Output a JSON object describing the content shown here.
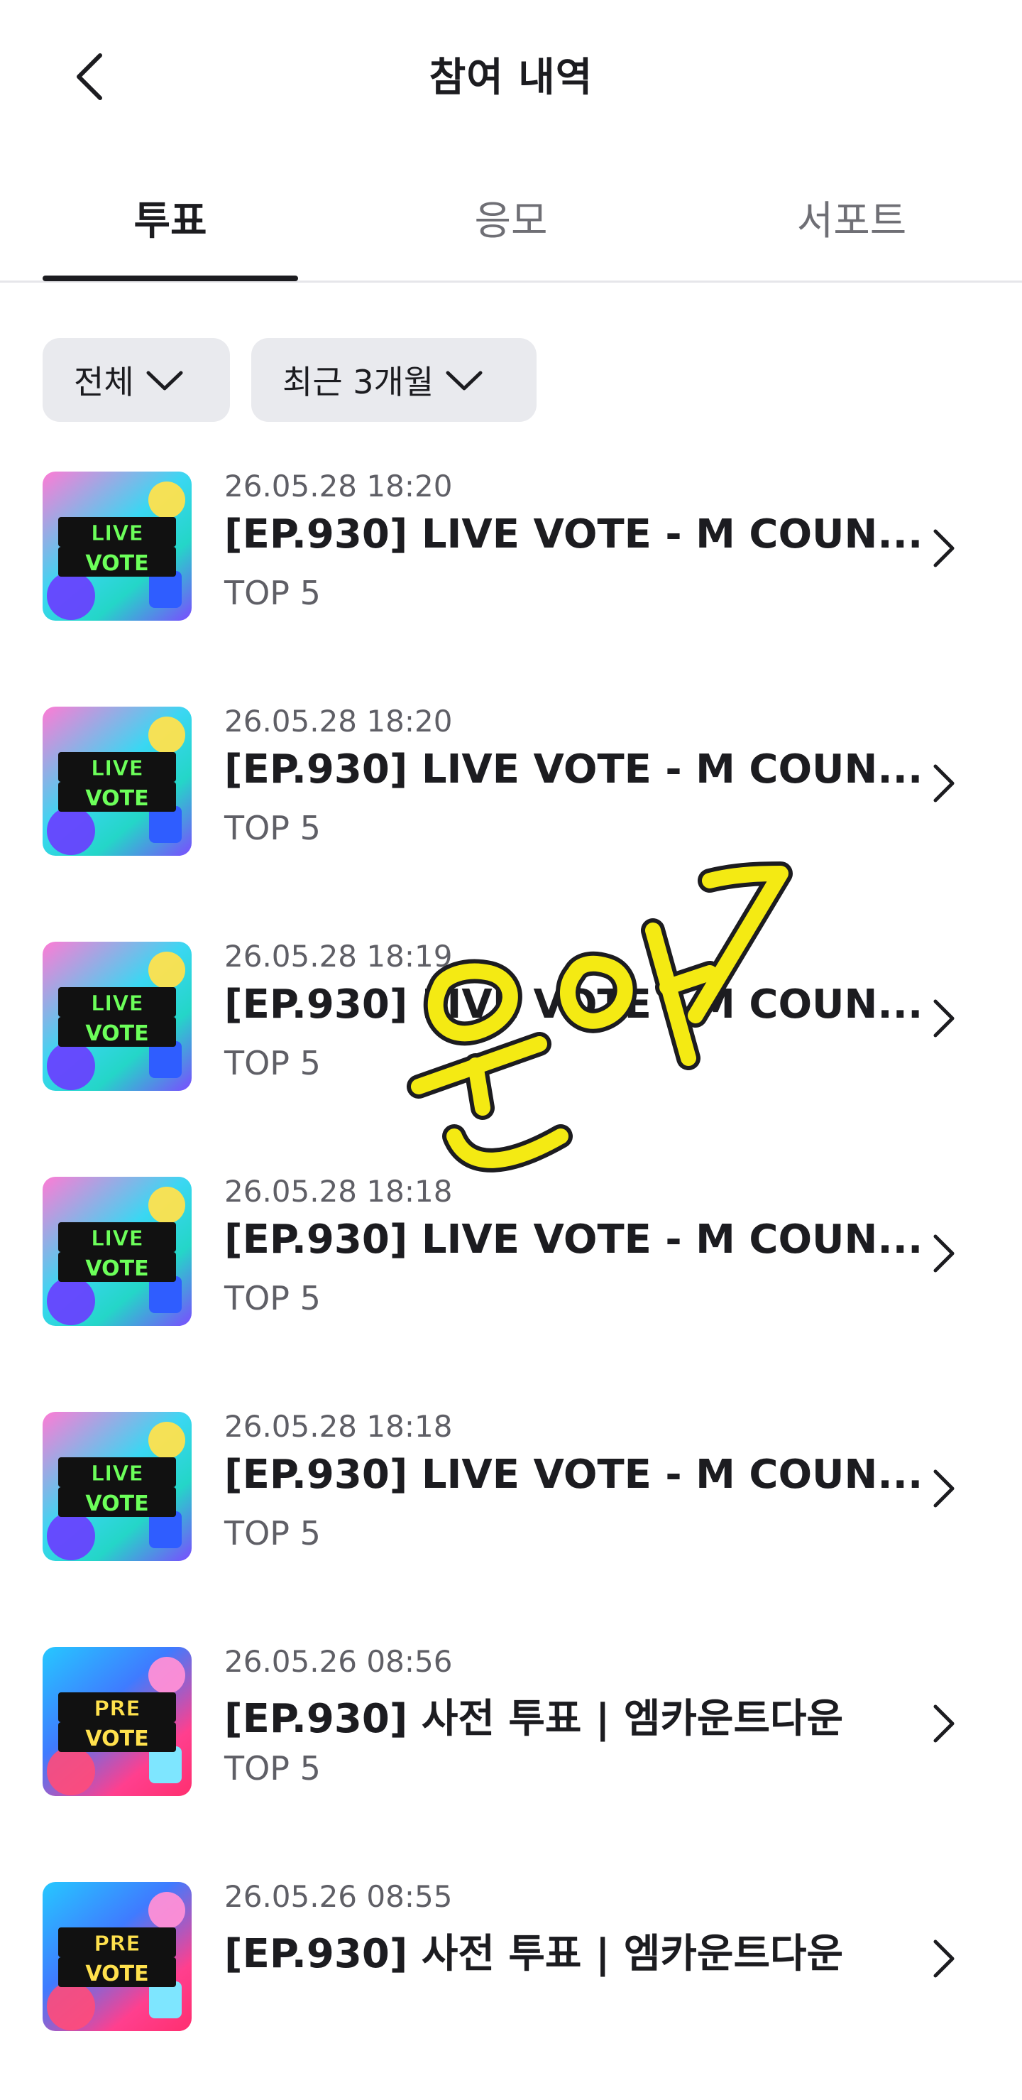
{
  "header": {
    "title": "참여 내역"
  },
  "tabs": [
    {
      "label": "투표"
    },
    {
      "label": "응모"
    },
    {
      "label": "서포트"
    }
  ],
  "filters": [
    {
      "value": "전체"
    },
    {
      "value": "최근 3개월"
    }
  ],
  "items": [
    {
      "date": "26.05.28 18:20",
      "title": "[EP.930] LIVE VOTE - M COUN...",
      "sub": "TOP 5",
      "thumb": [
        "LIVE",
        "VOTE"
      ]
    },
    {
      "date": "26.05.28 18:20",
      "title": "[EP.930] LIVE VOTE - M COUN...",
      "sub": "TOP 5",
      "thumb": [
        "LIVE",
        "VOTE"
      ]
    },
    {
      "date": "26.05.28 18:19",
      "title": "[EP.930] LIVE VOTE - M COUN...",
      "sub": "TOP 5",
      "thumb": [
        "LIVE",
        "VOTE"
      ]
    },
    {
      "date": "26.05.28 18:18",
      "title": "[EP.930] LIVE VOTE - M COUN...",
      "sub": "TOP 5",
      "thumb": [
        "LIVE",
        "VOTE"
      ]
    },
    {
      "date": "26.05.28 18:18",
      "title": "[EP.930] LIVE VOTE - M COUN...",
      "sub": "TOP 5",
      "thumb": [
        "LIVE",
        "VOTE"
      ]
    },
    {
      "date": "26.05.26 08:56",
      "title": "[EP.930] 사전 투표 | 엠카운트다운",
      "sub": "TOP 5",
      "thumb": [
        "PRE",
        "VOTE"
      ]
    },
    {
      "date": "26.05.26 08:55",
      "title": "[EP.930] 사전 투표 | 엠카운트다운",
      "sub": "",
      "thumb": [
        "PRE",
        "VOTE"
      ]
    }
  ],
  "watermark": {
    "text": "운아기",
    "color": "#f4ea13"
  },
  "colors": {
    "text": "#1c1c20",
    "muted": "#5f5f66",
    "chip": "#e9eaee",
    "divider": "#e6e6ea"
  }
}
